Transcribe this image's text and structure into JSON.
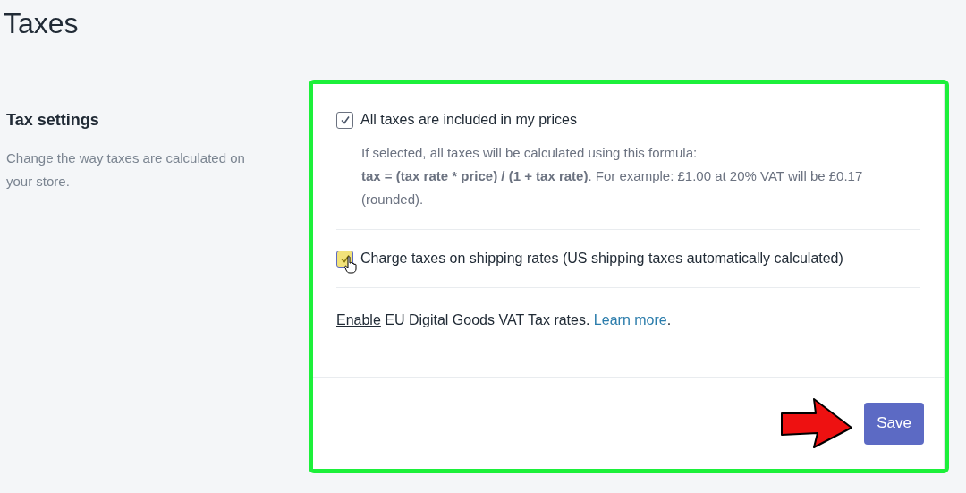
{
  "page": {
    "title": "Taxes"
  },
  "section": {
    "title": "Tax settings",
    "description": "Change the way taxes are calculated on your store."
  },
  "options": [
    {
      "kind": "checkbox",
      "label": "All taxes are included in my prices",
      "checked": true,
      "hovered": false,
      "description": [
        "If selected, all taxes will be calculated using this formula:",
        "**tax = (tax rate * price) / (1 + tax rate)**. For example: £1.00 at 20% VAT will be £0.17 (rounded)."
      ]
    },
    {
      "kind": "checkbox",
      "label": "Charge taxes on shipping rates (US shipping taxes automatically calculated)",
      "checked": true,
      "hovered": true
    },
    {
      "kind": "links",
      "enable_link": "Enable",
      "text": " EU Digital Goods VAT Tax rates. ",
      "learn_more_link": "Learn more",
      "end": "."
    }
  ],
  "save_button": "Save"
}
